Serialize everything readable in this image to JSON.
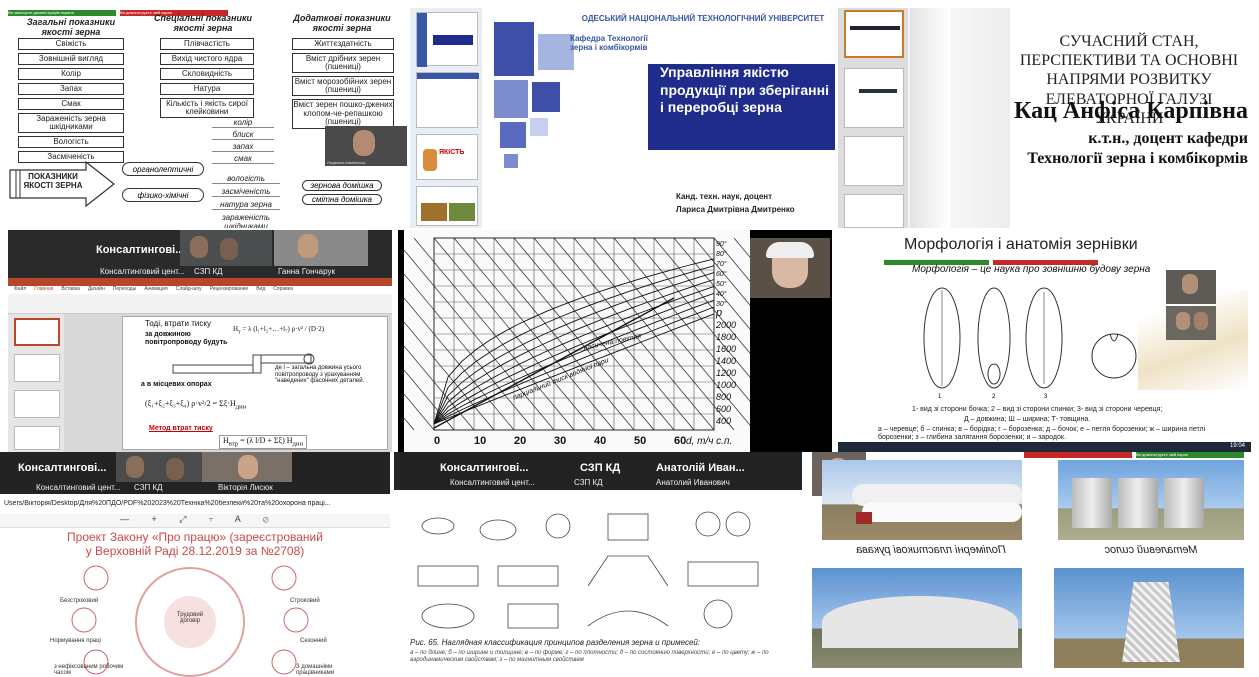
{
  "t1": {
    "bar_left": "Ви записуєте демонстрацію екрана",
    "bar_right": "Ви демонструєте свій екран",
    "col1_head": "Загальні показники якості зерна",
    "col1": [
      "Свіжість",
      "Зовнішній вигляд",
      "Колір",
      "Запах",
      "Смак",
      "Зараженість зерна шкідниками",
      "Вологість",
      "Засміченість"
    ],
    "col2_head": "Спеціальні показники якості зерна",
    "col2": [
      "Плівчастість",
      "Вихід чистого ядра",
      "Скловидність",
      "Натура",
      "Кількість і якість сирої клейковини"
    ],
    "col3_head": "Додаткові показники якості зерна",
    "col3": [
      "Життєздатність",
      "Вміст дрібних зерен (пшениці)",
      "Вміст морозобійних зерен (пшениці)",
      "Вміст зерен пошко-джених клопом-че-репашкою (пшениці)"
    ],
    "arrow": "ПОКАЗНИКИ ЯКОСТІ ЗЕРНА",
    "organo": "органолептичні",
    "physchem": "фізико-хімічні",
    "organo_items": [
      "колір",
      "блиск",
      "запах",
      "смак"
    ],
    "phys_items": [
      "вологість",
      "засміченість",
      "натура зерна",
      "зараженість шкідниками"
    ],
    "sub_items": [
      "зернова домішка",
      "смітна домішка"
    ],
    "person": "Людмила Каменська"
  },
  "t2": {
    "univ": "ОДЕСЬКИЙ НАЦІОНАЛЬНИЙ ТЕХНОЛОГІЧНИЙ УНІВЕРСИТЕТ",
    "dept": "Кафедра Технології зерна і комбікормів",
    "title": "Управління якістю продукції при зберіганні і переробці зерна",
    "author1": "Канд. техн. наук, доцент",
    "author2": "Лариса Дмитрівна Дмитренко",
    "thumb_title": "ЯКІСТЬ"
  },
  "t3": {
    "title": "СУЧАСНИЙ СТАН, ПЕРСПЕКТИВИ ТА ОСНОВНІ НАПРЯМИ РОЗВИТКУ ЕЛЕВАТОРНОЇ ГАЛУЗІ УКРАЇНИ",
    "name": "Кац Анфіса Карпівна",
    "pos1": "к.т.н., доцент кафедри",
    "pos2": "Технології зерна і комбікормів"
  },
  "t4": {
    "name": "Консалтингові...",
    "labels": [
      "Консалтинговий цент...",
      "СЗП КД",
      "Ганна Гончарук"
    ],
    "tabs": [
      "Файл",
      "Главная",
      "Вставка",
      "Дизайн",
      "Переходы",
      "Анимация",
      "Слайд-шоу",
      "Рецензирование",
      "Вид",
      "Справка"
    ],
    "t_text1": "Тоді, втрати тиску",
    "t_text2": "за довжиною повітропроводу будуть",
    "t_text3": "а в місцевих опорах",
    "t_text4": "де l – загальна довжина усього повітропроводу з урахуванням \"наведених\" фасонних деталей.",
    "t_text5": "Метод втрат тиску"
  },
  "t5": {
    "ylabels": [
      "2000",
      "1800",
      "1600",
      "1400",
      "1200",
      "1000",
      "800",
      "600",
      "400"
    ],
    "xlabels": [
      "0",
      "10",
      "20",
      "30",
      "40",
      "50",
      "60"
    ],
    "xunit": "d, т/ч с.п.",
    "rlabel": "p",
    "anno1": "насичена повітря",
    "anno2": "парціальний тиск водяної пари",
    "angles": [
      "90°",
      "80°",
      "70°",
      "60°",
      "50°",
      "40°",
      "30°"
    ]
  },
  "t6": {
    "title": "Морфологія і анатомія зернівки",
    "bullet": "Морфологія – це наука про зовнішню будову зерна",
    "cap1": "1- вид зі сторони бочка; 2 – вид зі сторони спинки; 3- вид зі сторони черевця;",
    "cap2": "Д – довжина; Ш – ширина; Т- товщина.",
    "cap3": "а – черевце; б – спинка; в – борідка; г – борозенка; д – бочок; е – петля борозенки; ж – ширина петлі борозенки; з – глибина залягання борозенки; и – зародок.",
    "nums": [
      "1",
      "2",
      "3"
    ],
    "time": "19:04"
  },
  "t7": {
    "name": "Консалтингові...",
    "labels": [
      "Консалтинговий цент...",
      "СЗП КД",
      "Вікторія Лисюк"
    ],
    "path": "Users/Вікторія/Desktop/Для%20ПДО/PDF%202023%20Техніка%20безпеки%20та%20охорона праці...",
    "title1": "Проект Закону «Про працю» (зареєстрований",
    "title2": "у Верховній Раді 28.12.2019 за №2708)",
    "center": "Трудовий договір",
    "items": [
      "Безстроковий",
      "Строковий",
      "Нормування праці",
      "Сезонний",
      "з нефіксованим робочим часом",
      "З домашніми працівниками"
    ]
  },
  "t8": {
    "names": [
      "Консалтингові...",
      "СЗП КД",
      "Анатолій Иван..."
    ],
    "labels": [
      "Консалтинговий цент...",
      "СЗП КД",
      "Анатолий Иванович"
    ],
    "caption": "Рис. 65. Наглядная классификация принципов разделения зерна и примесей:",
    "caption2": "а – по длине; б – по ширине и толщине; в – по форме; г – по плотности; д – по состоянию поверхности; е – по цвету; ж – по аэродинамическим свойствам; з – по магнитным свойствам"
  },
  "t9": {
    "bar": "Ви демонструєте свій екран",
    "cap1": "Полімерні пластикові рукава",
    "cap2": "Металевий силос"
  }
}
